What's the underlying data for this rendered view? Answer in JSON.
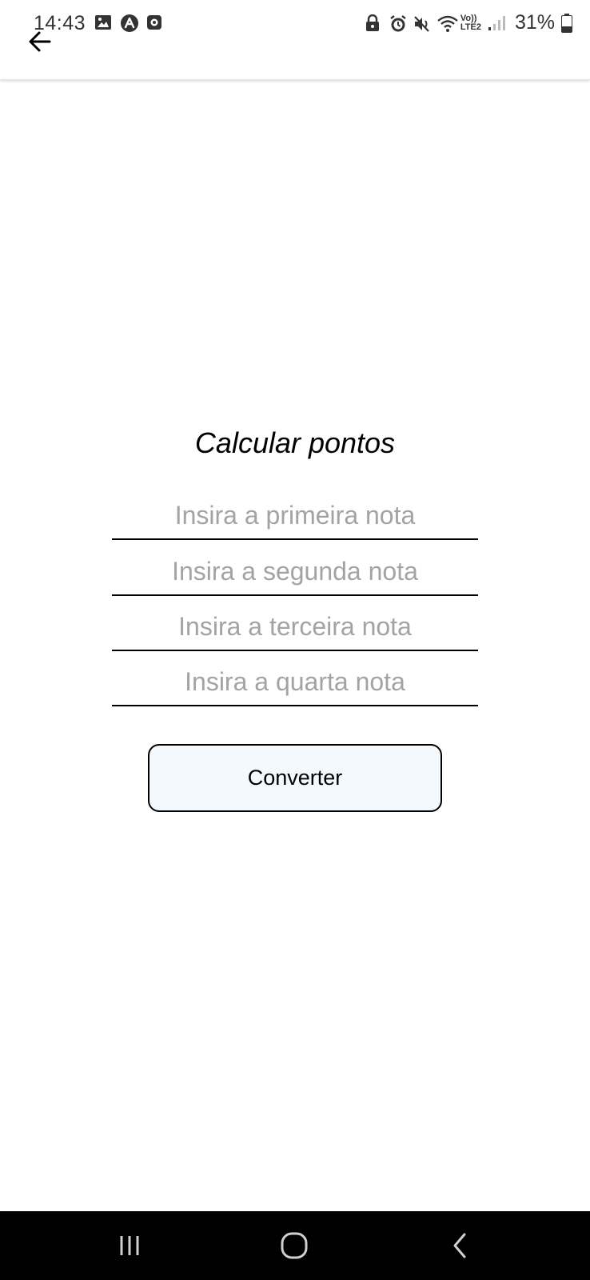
{
  "status_bar": {
    "time": "14:43",
    "left_icons": [
      "gallery-icon",
      "app-icon",
      "record-icon"
    ],
    "right_icons": [
      "lock-icon",
      "alarm-icon",
      "mute-icon",
      "wifi-icon",
      "volte-icon",
      "signal-icon",
      "battery-icon"
    ],
    "volte_label_top": "Vo))",
    "volte_label_bottom": "LTE2",
    "battery_percent": "31%"
  },
  "app_bar": {
    "back_icon": "arrow-left-icon"
  },
  "main": {
    "title": "Calcular pontos",
    "fields": {
      "first": {
        "value": "",
        "placeholder": "Insira a primeira nota"
      },
      "second": {
        "value": "",
        "placeholder": "Insira a segunda nota"
      },
      "third": {
        "value": "",
        "placeholder": "Insira a terceira nota"
      },
      "fourth": {
        "value": "",
        "placeholder": "Insira a quarta nota"
      }
    },
    "convert_label": "Converter"
  },
  "navigation": {
    "icons": [
      "recents-icon",
      "home-icon",
      "back-icon"
    ]
  },
  "colors": {
    "button_background": "#f3f9fd",
    "placeholder": "#a3a3a3",
    "nav_bar": "#000000"
  }
}
